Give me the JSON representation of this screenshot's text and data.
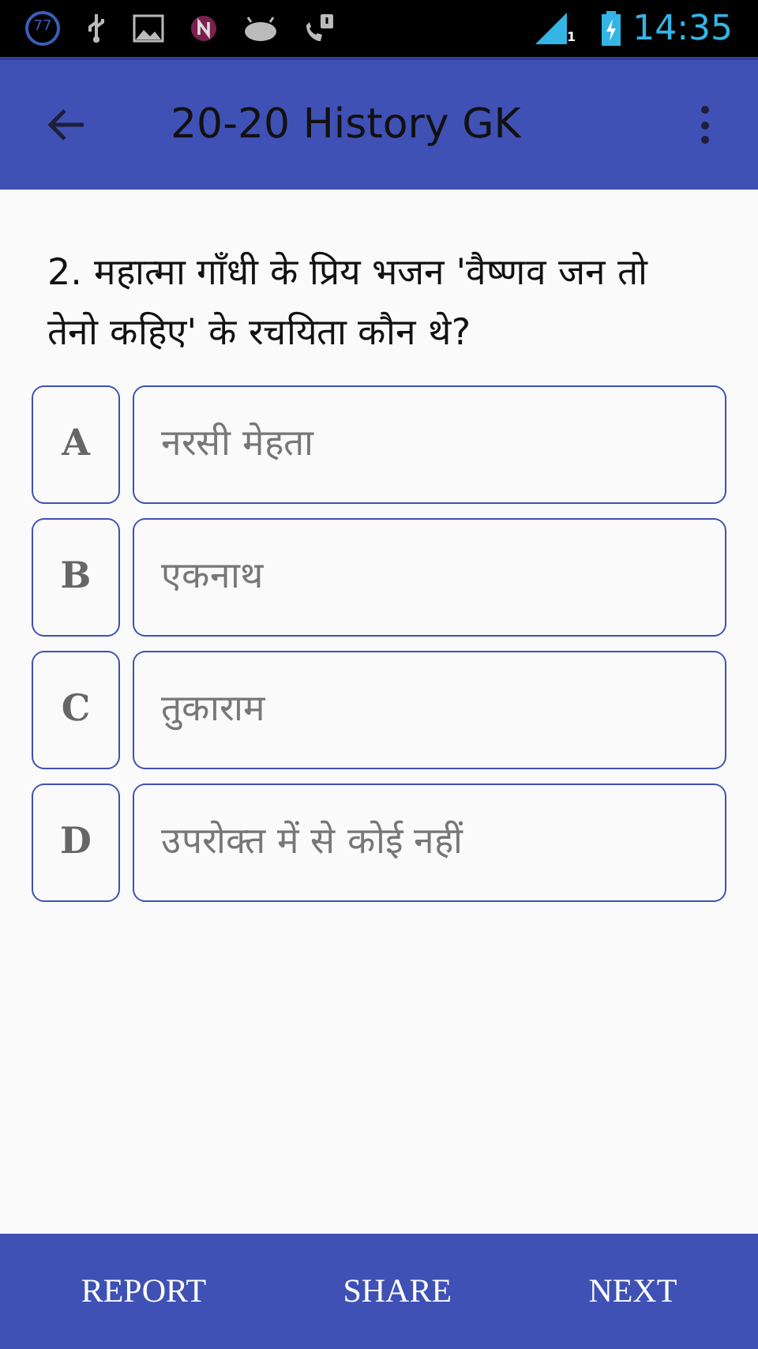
{
  "status_bar": {
    "notification_count": "77",
    "sim_number": "1",
    "time": "14:35"
  },
  "app_bar": {
    "title": "20-20 History GK"
  },
  "question": "2. महात्मा गाँधी के प्रिय भजन 'वैष्णव जन तो तेनो कहिए' के रचयिता कौन थे?",
  "options": [
    {
      "letter": "A",
      "text": "नरसी मेहता"
    },
    {
      "letter": "B",
      "text": "एकनाथ"
    },
    {
      "letter": "C",
      "text": "तुकाराम"
    },
    {
      "letter": "D",
      "text": "उपरोक्त में से कोई नहीं"
    }
  ],
  "bottom_bar": [
    "REPORT",
    "SHARE",
    "NEXT"
  ]
}
